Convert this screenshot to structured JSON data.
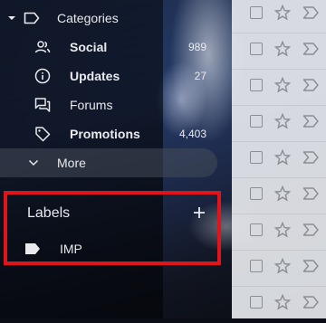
{
  "sidebar": {
    "categories_label": "Categories",
    "items": [
      {
        "label": "Social",
        "count": "989",
        "bold": true,
        "icon": "people-icon"
      },
      {
        "label": "Updates",
        "count": "27",
        "bold": true,
        "icon": "info-icon"
      },
      {
        "label": "Forums",
        "count": "",
        "bold": false,
        "icon": "forum-icon"
      },
      {
        "label": "Promotions",
        "count": "4,403",
        "bold": true,
        "icon": "tag-icon"
      }
    ],
    "more_label": "More"
  },
  "labels": {
    "title": "Labels",
    "add_icon": "plus-icon",
    "items": [
      {
        "label": "IMP",
        "icon": "label-icon"
      }
    ]
  },
  "colors": {
    "highlight_border": "#e0141b",
    "sidebar_text": "#e8eaed",
    "list_bg": "#e2e4e9"
  }
}
